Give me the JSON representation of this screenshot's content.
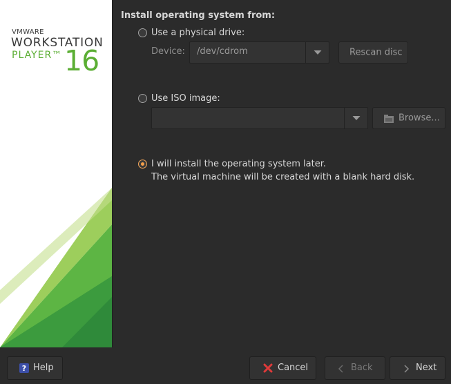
{
  "brand": {
    "vmware": "VMWARE",
    "product": "WORKSTATION",
    "edition": "PLAYER™",
    "version": "16"
  },
  "install": {
    "section_title": "Install operating system from:",
    "physical": {
      "label": "Use a physical drive:",
      "device_label": "Device:",
      "device_value": "/dev/cdrom",
      "rescan_label": "Rescan disc",
      "selected": false
    },
    "iso": {
      "label": "Use ISO image:",
      "path_value": "",
      "browse_label": "Browse...",
      "selected": false
    },
    "later": {
      "label": "I will install the operating system later.",
      "description": "The virtual machine will be created with a blank hard disk.",
      "selected": true
    }
  },
  "footer": {
    "help_label": "Help",
    "cancel_label": "Cancel",
    "back_label": "Back",
    "next_label": "Next"
  },
  "colors": {
    "background": "#2b2b2b",
    "accent_radio": "#f5a04a",
    "brand_green": "#5bae34",
    "brand_dark_green": "#2f8a3a"
  }
}
